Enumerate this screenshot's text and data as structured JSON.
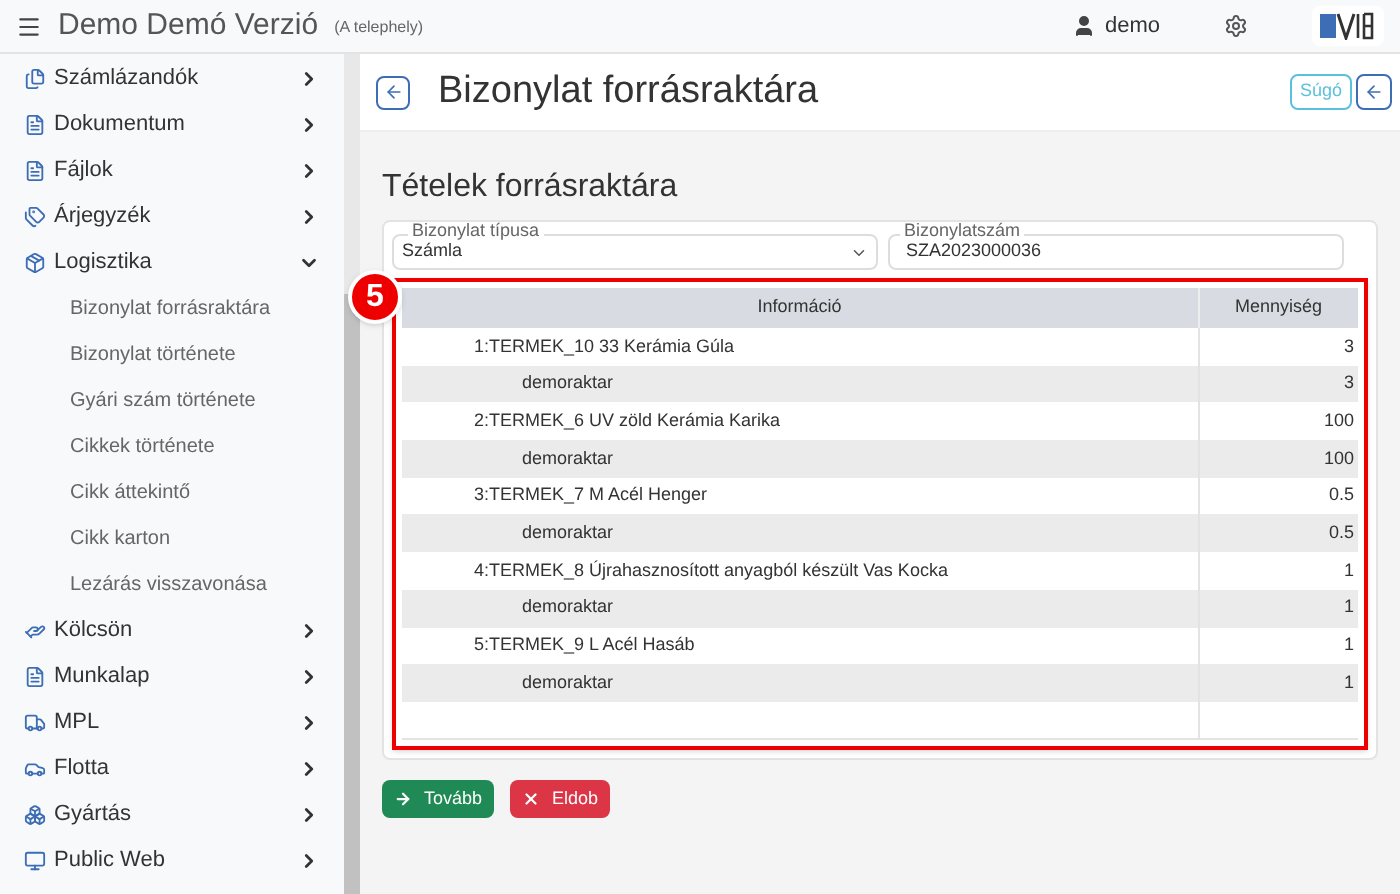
{
  "header": {
    "title": "Demo Demó Verzió",
    "site": "(A telephely)",
    "user": "demo"
  },
  "sidebar": {
    "items": [
      {
        "label": "Számlázandók",
        "expanded": false
      },
      {
        "label": "Dokumentum",
        "expanded": false
      },
      {
        "label": "Fájlok",
        "expanded": false
      },
      {
        "label": "Árjegyzék",
        "expanded": false
      },
      {
        "label": "Logisztika",
        "expanded": true,
        "children": [
          {
            "label": "Bizonylat forrásraktára"
          },
          {
            "label": "Bizonylat története"
          },
          {
            "label": "Gyári szám története"
          },
          {
            "label": "Cikkek története"
          },
          {
            "label": "Cikk áttekintő"
          },
          {
            "label": "Cikk karton"
          },
          {
            "label": "Lezárás visszavonása"
          }
        ]
      },
      {
        "label": "Kölcsön",
        "expanded": false
      },
      {
        "label": "Munkalap",
        "expanded": false
      },
      {
        "label": "MPL",
        "expanded": false
      },
      {
        "label": "Flotta",
        "expanded": false
      },
      {
        "label": "Gyártás",
        "expanded": false
      },
      {
        "label": "Public Web",
        "expanded": false
      }
    ]
  },
  "page": {
    "title": "Bizonylat forrásraktára",
    "help": "Súgó",
    "section": "Tételek forrásraktára"
  },
  "form": {
    "doc_type": {
      "label": "Bizonylat típusa",
      "value": "Számla"
    },
    "doc_number": {
      "label": "Bizonylatszám",
      "value": "SZA2023000036"
    }
  },
  "callout": "5",
  "table": {
    "columns": [
      "Információ",
      "Mennyiség"
    ],
    "rows": [
      {
        "kind": "item",
        "info": "1:TERMEK_10 33 Kerámia Gúla",
        "qty": "3"
      },
      {
        "kind": "stock",
        "info": "demoraktar",
        "qty": "3"
      },
      {
        "kind": "item",
        "info": "2:TERMEK_6 UV zöld Kerámia Karika",
        "qty": "100"
      },
      {
        "kind": "stock",
        "info": "demoraktar",
        "qty": "100"
      },
      {
        "kind": "item",
        "info": "3:TERMEK_7 M Acél Henger",
        "qty": "0.5"
      },
      {
        "kind": "stock",
        "info": "demoraktar",
        "qty": "0.5"
      },
      {
        "kind": "item",
        "info": "4:TERMEK_8 Újrahasznosított anyagból készült Vas Kocka",
        "qty": "1"
      },
      {
        "kind": "stock",
        "info": "demoraktar",
        "qty": "1"
      },
      {
        "kind": "item",
        "info": "5:TERMEK_9 L Acél Hasáb",
        "qty": "1"
      },
      {
        "kind": "stock",
        "info": "demoraktar",
        "qty": "1"
      }
    ]
  },
  "buttons": [
    {
      "kind": "next",
      "label": "Tovább"
    },
    {
      "kind": "discard",
      "label": "Eldob"
    }
  ]
}
